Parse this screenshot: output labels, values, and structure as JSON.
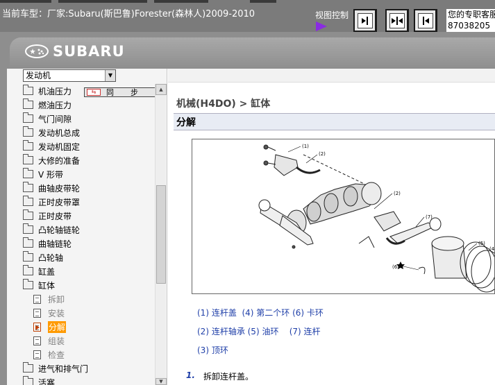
{
  "header": {
    "current_model": "当前车型：厂家:Subaru(斯巴鲁)Forester(森林人)2009-2010",
    "view_control": "视图控制",
    "help_line1": "您的专职客服",
    "help_line2": "87038205"
  },
  "banner": {
    "logo_text": "SUBARU"
  },
  "sidebar": {
    "system_select": "发动机",
    "sync_label": "同步",
    "items": [
      {
        "label": "机油压力",
        "type": "folder"
      },
      {
        "label": "燃油压力",
        "type": "folder"
      },
      {
        "label": "气门间隙",
        "type": "folder"
      },
      {
        "label": "发动机总成",
        "type": "folder"
      },
      {
        "label": "发动机固定",
        "type": "folder"
      },
      {
        "label": "大修的准备",
        "type": "folder"
      },
      {
        "label": "V 形带",
        "type": "folder"
      },
      {
        "label": "曲轴皮带轮",
        "type": "folder"
      },
      {
        "label": "正时皮带罩",
        "type": "folder"
      },
      {
        "label": "正时皮带",
        "type": "folder"
      },
      {
        "label": "凸轮轴链轮",
        "type": "folder"
      },
      {
        "label": "曲轴链轮",
        "type": "folder"
      },
      {
        "label": "凸轮轴",
        "type": "folder"
      },
      {
        "label": "缸盖",
        "type": "folder"
      },
      {
        "label": "缸体",
        "type": "folder-open"
      },
      {
        "label": "拆卸",
        "type": "doc"
      },
      {
        "label": "安装",
        "type": "doc"
      },
      {
        "label": "分解",
        "type": "doc-selected"
      },
      {
        "label": "组装",
        "type": "doc"
      },
      {
        "label": "检查",
        "type": "doc"
      },
      {
        "label": "进气和排气门",
        "type": "folder"
      },
      {
        "label": "活塞",
        "type": "folder"
      }
    ]
  },
  "main": {
    "breadcrumb": "机械(H4DO) > 缸体",
    "section_title": "分解",
    "figure_callouts": [
      "(1)",
      "(2)",
      "(2)",
      "(7)",
      "(6)",
      "(5)",
      "(4)"
    ],
    "legend": [
      "(1) 连杆盖  (4) 第二个环 (6) 卡环",
      "(2) 连杆轴承 (5) 油环    (7) 连杆",
      "(3) 顶环"
    ],
    "step": {
      "number": "1.",
      "text": "拆卸连杆盖。"
    }
  },
  "colors": {
    "topbar": "#7b7b7b",
    "banner": "#8e8e8e",
    "link_blue": "#1f3fa8",
    "selected_orange": "#ff9a00",
    "view_arrow": "#8a2be2"
  }
}
